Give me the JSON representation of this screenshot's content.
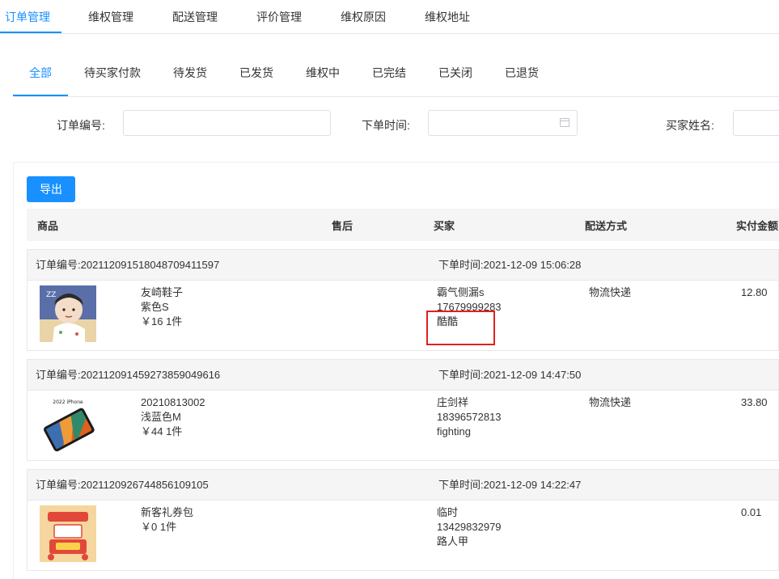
{
  "top_nav": {
    "items": [
      {
        "label": "订单管理",
        "active": true
      },
      {
        "label": "维权管理",
        "active": false
      },
      {
        "label": "配送管理",
        "active": false
      },
      {
        "label": "评价管理",
        "active": false
      },
      {
        "label": "维权原因",
        "active": false
      },
      {
        "label": "维权地址",
        "active": false
      }
    ]
  },
  "status_tabs": {
    "items": [
      {
        "label": "全部",
        "active": true
      },
      {
        "label": "待买家付款",
        "active": false
      },
      {
        "label": "待发货",
        "active": false
      },
      {
        "label": "已发货",
        "active": false
      },
      {
        "label": "维权中",
        "active": false
      },
      {
        "label": "已完结",
        "active": false
      },
      {
        "label": "已关闭",
        "active": false
      },
      {
        "label": "已退货",
        "active": false
      }
    ]
  },
  "filters": {
    "order_no_label": "订单编号:",
    "order_no_value": "",
    "order_time_label": "下单时间:",
    "order_time_value": "",
    "buyer_name_label": "买家姓名:",
    "buyer_name_value": ""
  },
  "toolbar": {
    "export_label": "导出"
  },
  "table": {
    "columns": [
      "商品",
      "售后",
      "买家",
      "配送方式",
      "实付金额"
    ]
  },
  "orders": [
    {
      "order_no_text": "订单编号:202112091518048709411597",
      "order_time_text": "下单时间:2021-12-09 15:06:28",
      "product_name": "友崎鞋子",
      "product_spec": "紫色S",
      "product_price_qty": "￥16   1件",
      "buyer_name": "霸气侧漏s",
      "buyer_phone": "17679999283",
      "buyer_note": "酷酷",
      "delivery": "物流快递",
      "amount": "12.80",
      "thumb_icon": "cartoon-character-thumbnail"
    },
    {
      "order_no_text": "订单编号:202112091459273859049616",
      "order_time_text": "下单时间:2021-12-09 14:47:50",
      "product_name": "20210813002",
      "product_spec": "浅蓝色M",
      "product_price_qty": "￥44   1件",
      "buyer_name": "庄剑祥",
      "buyer_phone": "18396572813",
      "buyer_note": "fighting",
      "delivery": "物流快递",
      "amount": "33.80",
      "thumb_caption": "2022 iPhone",
      "thumb_icon": "phone-product-thumbnail"
    },
    {
      "order_no_text": "订单编号:202112092674485610910 5",
      "order_time_text": "下单时间:2021-12-09 14:22:47",
      "product_name": "新客礼券包",
      "product_spec": "",
      "product_price_qty": "￥0   1件",
      "buyer_name": "临时",
      "buyer_phone": "13429832979",
      "buyer_note": "路人甲",
      "delivery": "",
      "amount": "0.01",
      "thumb_icon": "gift-coupon-thumbnail"
    }
  ],
  "colors": {
    "accent": "#1890ff",
    "highlight": "#e02020",
    "header_bg": "#f5f5f5"
  }
}
